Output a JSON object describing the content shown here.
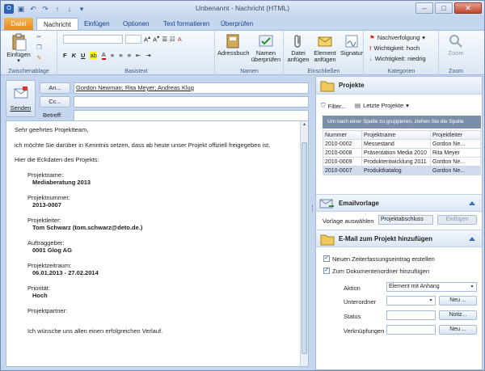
{
  "window": {
    "title": "Unbenannt - Nachricht (HTML)",
    "qat_icons": [
      "outlook-icon",
      "save-icon",
      "undo-icon",
      "redo-icon",
      "up-icon",
      "down-icon",
      "customize-icon"
    ],
    "controls": [
      "–",
      "□",
      "✕"
    ]
  },
  "tabs": [
    "Datei",
    "Nachricht",
    "Einfügen",
    "Optionen",
    "Text formatieren",
    "Überprüfen"
  ],
  "ribbon": {
    "clipboard": {
      "paste": "Einfügen",
      "label": "Zwischenablage"
    },
    "basictext": {
      "label": "Basistext"
    },
    "names": {
      "addressbook": "Adressbuch",
      "check_names": "Namen überprüfen",
      "label": "Namen"
    },
    "include": {
      "attach_file": "Datei anfügen",
      "attach_item": "Element anfügen",
      "signature": "Signatur",
      "label": "Einschließen"
    },
    "tags": {
      "followup": "Nachverfolgung",
      "high": "Wichtigkeit: hoch",
      "low": "Wichtigkeit: niedrig",
      "label": "Kategorien"
    },
    "zoom": {
      "zoom": "Zoom",
      "label": "Zoom"
    }
  },
  "compose": {
    "send": "Senden",
    "to_label": "An...",
    "to_value": "Gordon Newman; Rita Meyer; Andreas Klug",
    "cc_label": "Cc...",
    "cc_value": "",
    "subject_label": "Betreff:",
    "subject_value": ""
  },
  "body": {
    "greeting": "Sehr geehrtes Projektteam,",
    "line1": "ich möchte Sie darüber in Kenntnis setzen, dass ab heute unser Projekt offiziell freigegeben ist.",
    "line2": "Hier die Eckdaten des Projekts:",
    "fields": [
      {
        "label": "Projektname:",
        "value": "Mediaberatung 2013"
      },
      {
        "label": "Projektnummer:",
        "value": "2013-0007"
      },
      {
        "label": "Projektleiter:",
        "value": "Tom Schwarz (tom.schwarz@deto.de.)"
      },
      {
        "label": "Auftraggeber:",
        "value": "0001 Glog AG"
      },
      {
        "label": "Projektzeitraum:",
        "value": "06.01.2013 - 27.02.2014"
      },
      {
        "label": "Priorität:",
        "value": "Hoch"
      },
      {
        "label": "Projektpartner:",
        "value": ""
      }
    ],
    "closing": "Ich wünsche uns allen einen erfolgreichen Verlauf."
  },
  "pane": {
    "projects_title": "Projekte",
    "filter": "Filter...",
    "last_projects": "Letzte Projekte",
    "group_hint": "Um nach einer Spalte zu gruppieren, ziehen Sie die Spalte",
    "columns": [
      "Nummer",
      "Projektname",
      "Projektleiter"
    ],
    "rows": [
      [
        "2010-0002",
        "Messestand",
        "Gordon Ne..."
      ],
      [
        "2010-0008",
        "Präsentation Media 2010",
        "Rita Meyer"
      ],
      [
        "2010-0009",
        "Produktentwicklung 2011",
        "Gordon Ne..."
      ],
      [
        "2010-0007",
        "Produktkatalog",
        "Gordon Ne..."
      ]
    ],
    "selected_row": 3,
    "email_template_title": "Emailvorlage",
    "template_label": "Vorlage auswählen",
    "template_value": "Projektabschluss",
    "insert_btn": "Einfügen",
    "email_project_title": "E-Mail zum Projekt hinzufügen",
    "chk1": "Neuen Zeiterfassungseintrag erstellen",
    "chk2": "Zum Dokumentenordner hinzufügen",
    "action_label": "Aktion",
    "action_value": "Element mit Anhang",
    "subfolder_label": "Unterordner",
    "new_btn": "Neu ...",
    "status_label": "Status",
    "note_btn": "Notiz...",
    "links_label": "Verknüpfungen",
    "new_btn2": "Neu ..."
  }
}
